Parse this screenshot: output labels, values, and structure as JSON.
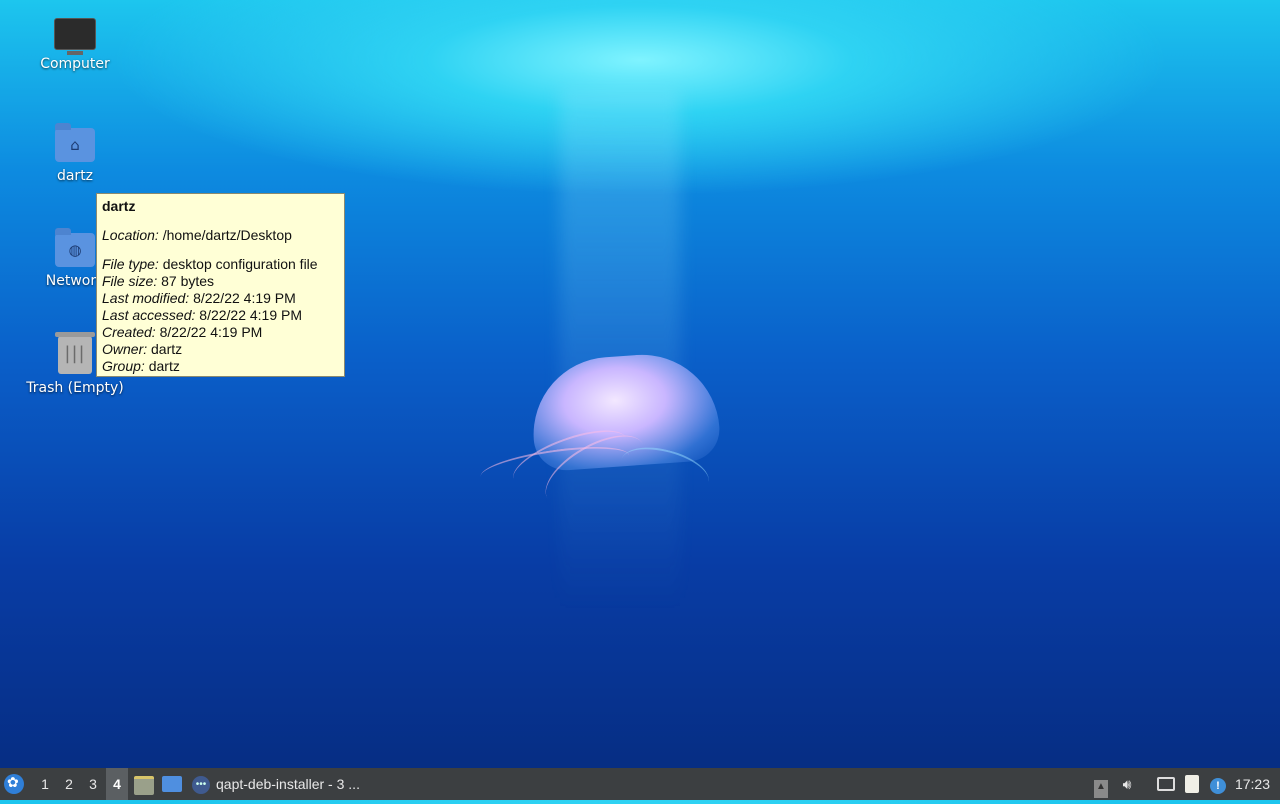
{
  "desktop": {
    "icons": [
      {
        "label": "Computer",
        "icon": "computer-icon"
      },
      {
        "label": "dartz",
        "icon": "home-folder-icon"
      },
      {
        "label": "Network",
        "icon": "network-folder-icon"
      },
      {
        "label": "Trash (Empty)",
        "icon": "trash-icon"
      }
    ]
  },
  "tooltip": {
    "title": "dartz",
    "rows": [
      {
        "key": "Location:",
        "value": "/home/dartz/Desktop"
      },
      {
        "key": "File type:",
        "value": "desktop configuration file"
      },
      {
        "key": "File size:",
        "value": "87 bytes"
      },
      {
        "key": "Last modified:",
        "value": "8/22/22 4:19 PM"
      },
      {
        "key": "Last accessed:",
        "value": "8/22/22 4:19 PM"
      },
      {
        "key": "Created:",
        "value": "8/22/22 4:19 PM"
      },
      {
        "key": "Owner:",
        "value": "dartz"
      },
      {
        "key": "Group:",
        "value": "dartz"
      }
    ]
  },
  "taskbar": {
    "workspaces": [
      "1",
      "2",
      "3",
      "4"
    ],
    "active_workspace": "4",
    "launchers": [
      "file-manager-icon",
      "show-desktop-icon"
    ],
    "task_label": "qapt-deb-installer - 3 ...",
    "tray": [
      "eject-icon",
      "volume-icon",
      "network-icon",
      "clipboard-icon",
      "update-notifier-icon"
    ],
    "clock": "17:23"
  }
}
